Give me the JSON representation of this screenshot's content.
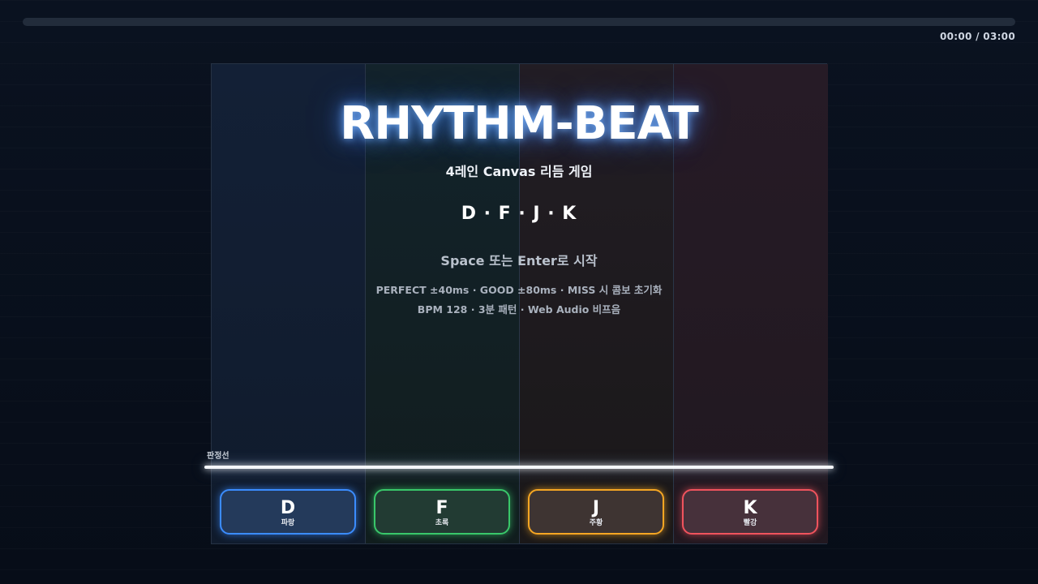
{
  "progress": {
    "fraction": 0.0,
    "time_text": "00:00 / 03:00"
  },
  "title": {
    "main": "RHYTHM-BEAT",
    "subtitle": "4레인 Canvas 리듬 게임",
    "keys": "D · F · J · K",
    "start_hint": "Space 또는 Enter로 시작",
    "rules_1": "PERFECT ±40ms · GOOD ±80ms · MISS 시 콤보 초기화",
    "rules_2": "BPM 128 · 3분 패턴 · Web Audio 비프음"
  },
  "judge_label": "판정선",
  "lanes": [
    {
      "key": "D",
      "color_name": "파랑",
      "color": "#3b8cff"
    },
    {
      "key": "F",
      "color_name": "초록",
      "color": "#39c76a"
    },
    {
      "key": "J",
      "color_name": "주황",
      "color": "#f5a623"
    },
    {
      "key": "K",
      "color_name": "빨강",
      "color": "#f0535d"
    }
  ]
}
